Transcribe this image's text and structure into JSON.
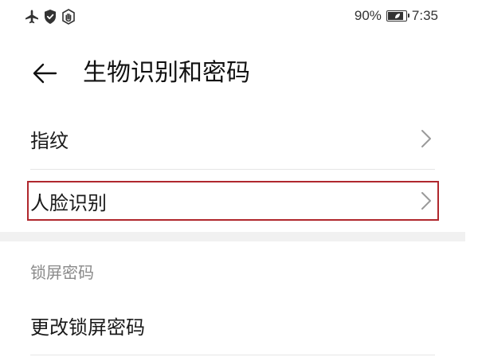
{
  "status_bar": {
    "battery_percent": "90%",
    "battery_level": 0.9,
    "time": "7:35",
    "icons": [
      "airplane-icon",
      "shield-icon",
      "hand-icon",
      "battery-icon"
    ]
  },
  "header": {
    "back_icon": "back-arrow-icon",
    "title": "生物识别和密码"
  },
  "list": {
    "items": [
      {
        "label": "指纹",
        "icon": "chevron-right-icon"
      },
      {
        "label": "人脸识别",
        "icon": "chevron-right-icon",
        "highlighted": true
      }
    ]
  },
  "section": {
    "header": "锁屏密码",
    "items": [
      {
        "label": "更改锁屏密码"
      }
    ]
  },
  "colors": {
    "highlight": "#b0272d",
    "divider": "#e6e6e6",
    "section_gap": "#f1f1f1",
    "secondary_text": "#8a8a8a",
    "chevron": "#9a9a9a"
  }
}
